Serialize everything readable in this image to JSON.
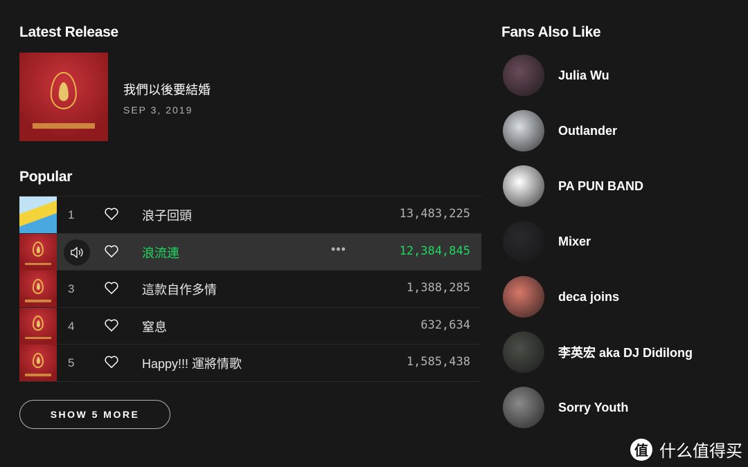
{
  "latest_release": {
    "heading": "Latest Release",
    "title": "我們以後要結婚",
    "date": "SEP 3, 2019"
  },
  "popular": {
    "heading": "Popular",
    "tracks": [
      {
        "num": "1",
        "title": "浪子回頭",
        "plays": "13,483,225",
        "cover": "colorful"
      },
      {
        "num": "2",
        "title": "浪流連",
        "plays": "12,384,845",
        "playing": true,
        "more": "•••"
      },
      {
        "num": "3",
        "title": "這款自作多情",
        "plays": "1,388,285"
      },
      {
        "num": "4",
        "title": "窒息",
        "plays": "632,634"
      },
      {
        "num": "5",
        "title": "Happy!!! 運將情歌",
        "plays": "1,585,438"
      }
    ],
    "show_more": "SHOW 5 MORE"
  },
  "fans_also_like": {
    "heading": "Fans Also Like",
    "artists": [
      {
        "name": "Julia Wu",
        "color": "#6a4a5a"
      },
      {
        "name": "Outlander",
        "color": "#d8dde2"
      },
      {
        "name": "PA PUN BAND",
        "color": "#ffffff"
      },
      {
        "name": "Mixer",
        "color": "#2a2a2e"
      },
      {
        "name": "deca joins",
        "color": "#d9776a"
      },
      {
        "name": "李英宏 aka DJ Didilong",
        "color": "#4a4f48"
      },
      {
        "name": "Sorry Youth",
        "color": "#8a8a8a"
      }
    ]
  },
  "accent": "#1ed760",
  "watermark": {
    "logo": "值",
    "text": "什么值得买"
  }
}
